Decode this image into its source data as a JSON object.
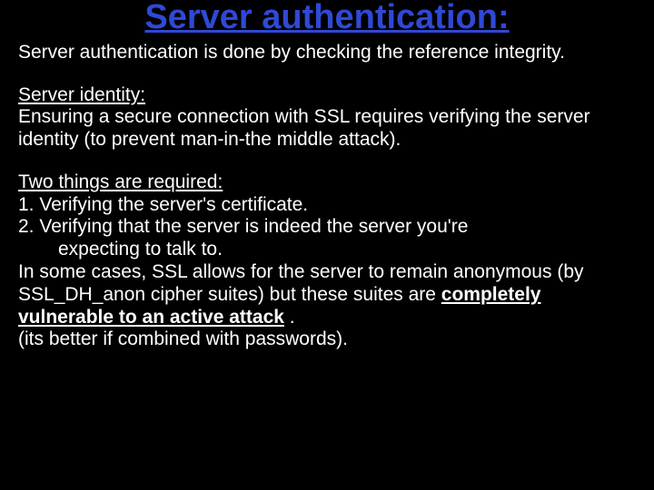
{
  "title": "Server authentication:",
  "intro": "Server authentication is done by checking the reference integrity.",
  "section1_heading": "Server identity:",
  "section1_body": "Ensuring a secure connection with SSL requires verifying the server identity (to prevent man-in-the middle attack).",
  "section2_heading": "Two things are required:",
  "item1": "1. Verifying the server's certificate.",
  "item2_line1": "2. Verifying that the server is indeed the server you're",
  "item2_line2": "expecting to talk to.",
  "note_pre": "In some cases, SSL allows for the server to remain anonymous (by SSL_DH_anon cipher suites) but these suites are ",
  "note_bold": "completely vulnerable to an active attack",
  "note_post": " .",
  "closing": "(its better if combined with passwords)."
}
